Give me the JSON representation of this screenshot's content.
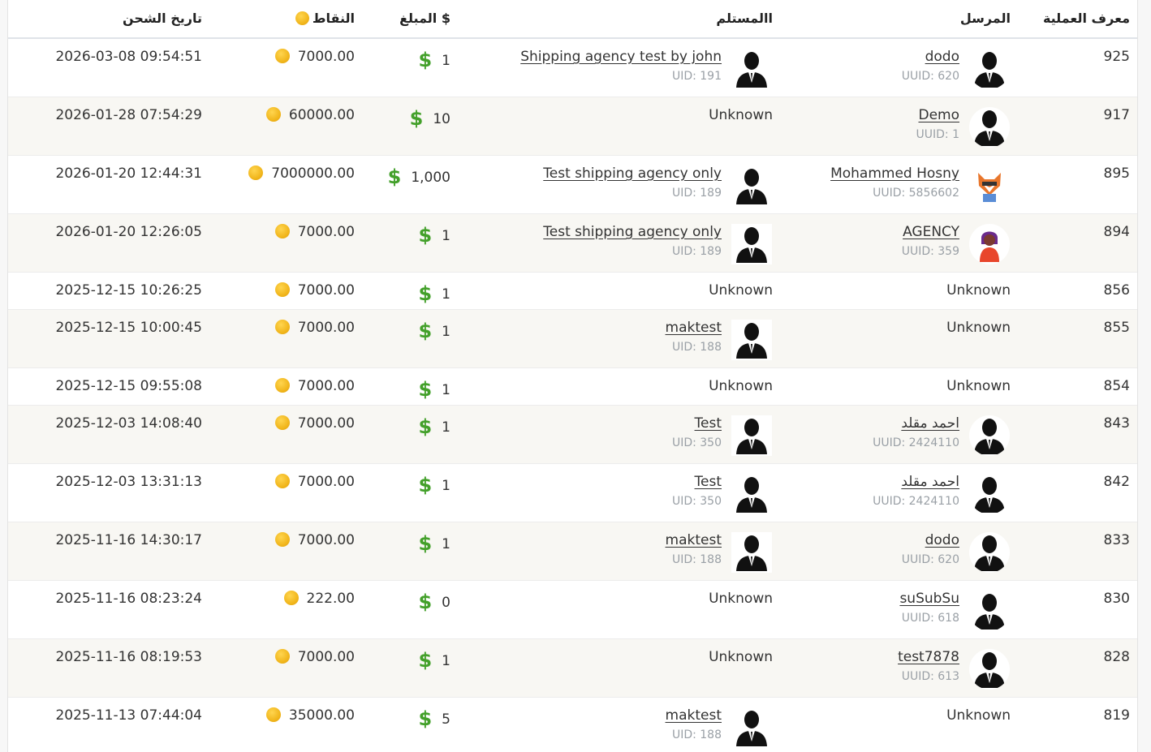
{
  "headers": {
    "id": "معرف العملية",
    "sender": "المرسل",
    "receiver": "االمستلم",
    "amount": "المبلغ $",
    "points": "النقاط",
    "date": "تاريخ الشحن"
  },
  "rows": [
    {
      "id": "925",
      "sender": {
        "name": "dodo",
        "uid": "UUID: 620",
        "avatar": "person-icon"
      },
      "receiver": {
        "name": "Shipping agency test by john",
        "uid": "UID: 191",
        "avatar": "person-icon"
      },
      "amount": "1",
      "points": "7000.00",
      "date": "2026-03-08 09:54:51"
    },
    {
      "id": "917",
      "sender": {
        "name": "Demo",
        "uid": "UUID: 1",
        "avatar": "person-icon"
      },
      "receiver": {
        "unknown": "Unknown"
      },
      "amount": "10",
      "points": "60000.00",
      "date": "2026-01-28 07:54:29"
    },
    {
      "id": "895",
      "sender": {
        "name": "Mohammed Hosny",
        "uid": "UUID: 5856602",
        "avatar": "fox-icon"
      },
      "receiver": {
        "name": "Test shipping agency only",
        "uid": "UID: 189",
        "avatar": "person-icon"
      },
      "amount": "1,000",
      "points": "7000000.00",
      "date": "2026-01-20 12:44:31"
    },
    {
      "id": "894",
      "sender": {
        "name": "AGENCY",
        "uid": "UUID: 359",
        "avatar": "girl-icon"
      },
      "receiver": {
        "name": "Test shipping agency only",
        "uid": "UID: 189",
        "avatar": "person-icon"
      },
      "amount": "1",
      "points": "7000.00",
      "date": "2026-01-20 12:26:05"
    },
    {
      "id": "856",
      "sender": {
        "unknown": "Unknown"
      },
      "receiver": {
        "unknown": "Unknown"
      },
      "amount": "1",
      "points": "7000.00",
      "date": "2025-12-15 10:26:25"
    },
    {
      "id": "855",
      "sender": {
        "unknown": "Unknown"
      },
      "receiver": {
        "name": "maktest",
        "uid": "UID: 188",
        "avatar": "person-icon"
      },
      "amount": "1",
      "points": "7000.00",
      "date": "2025-12-15 10:00:45"
    },
    {
      "id": "854",
      "sender": {
        "unknown": "Unknown"
      },
      "receiver": {
        "unknown": "Unknown"
      },
      "amount": "1",
      "points": "7000.00",
      "date": "2025-12-15 09:55:08"
    },
    {
      "id": "843",
      "sender": {
        "name": "احمد مقلد",
        "uid": "UUID: 2424110",
        "avatar": "person-icon"
      },
      "receiver": {
        "name": "Test",
        "uid": "UID: 350",
        "avatar": "person-icon"
      },
      "amount": "1",
      "points": "7000.00",
      "date": "2025-12-03 14:08:40"
    },
    {
      "id": "842",
      "sender": {
        "name": "احمد مقلد",
        "uid": "UUID: 2424110",
        "avatar": "person-icon"
      },
      "receiver": {
        "name": "Test",
        "uid": "UID: 350",
        "avatar": "person-icon"
      },
      "amount": "1",
      "points": "7000.00",
      "date": "2025-12-03 13:31:13"
    },
    {
      "id": "833",
      "sender": {
        "name": "dodo",
        "uid": "UUID: 620",
        "avatar": "person-icon"
      },
      "receiver": {
        "name": "maktest",
        "uid": "UID: 188",
        "avatar": "person-icon"
      },
      "amount": "1",
      "points": "7000.00",
      "date": "2025-11-16 14:30:17"
    },
    {
      "id": "830",
      "sender": {
        "name": "suSubSu",
        "uid": "UUID: 618",
        "avatar": "person-icon"
      },
      "receiver": {
        "unknown": "Unknown"
      },
      "amount": "0",
      "points": "222.00",
      "date": "2025-11-16 08:23:24"
    },
    {
      "id": "828",
      "sender": {
        "name": "test7878",
        "uid": "UUID: 613",
        "avatar": "person-icon"
      },
      "receiver": {
        "unknown": "Unknown"
      },
      "amount": "1",
      "points": "7000.00",
      "date": "2025-11-16 08:19:53"
    },
    {
      "id": "819",
      "sender": {
        "unknown": "Unknown"
      },
      "receiver": {
        "name": "maktest",
        "uid": "UID: 188",
        "avatar": "person-icon"
      },
      "amount": "5",
      "points": "35000.00",
      "date": "2025-11-13 07:44:04"
    }
  ],
  "icons": {
    "dollar": "$",
    "coin": "coin-icon"
  },
  "colors": {
    "dollar": "#43a02a",
    "coin": "#f0b419",
    "alt_row": "#f8f7f3",
    "uid": "#9aa0a6"
  }
}
